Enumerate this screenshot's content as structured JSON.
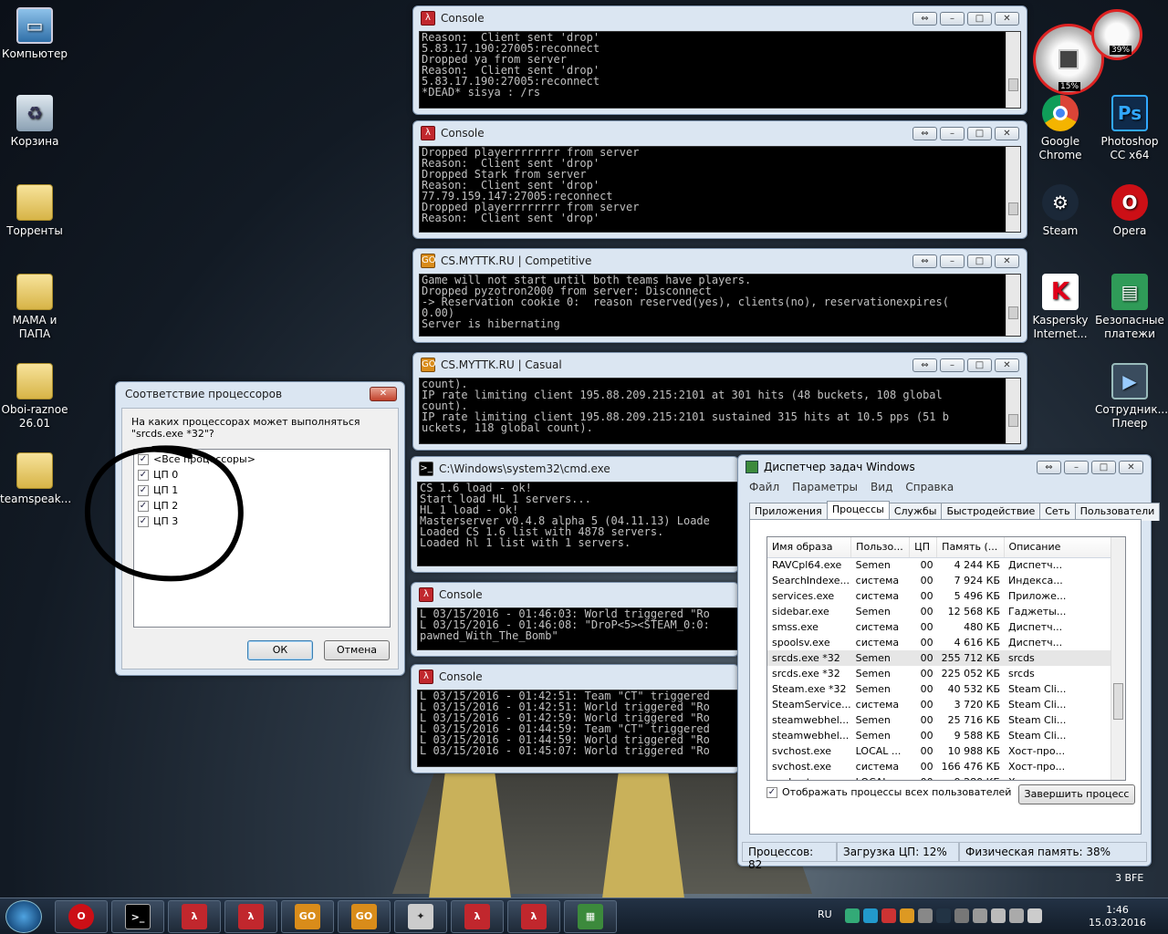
{
  "desktop": {
    "left_icons": [
      {
        "label": "Компьютер",
        "name": "computer-icon"
      },
      {
        "label": "Корзина",
        "name": "recycle-bin-icon"
      },
      {
        "label": "Торренты",
        "name": "folder-icon"
      },
      {
        "label": "МАМА и ПАПА",
        "name": "folder-icon"
      },
      {
        "label": "Oboi-raznoe 26.01",
        "name": "folder-icon"
      },
      {
        "label": "teamspeak...",
        "name": "folder-icon"
      }
    ],
    "right_icons": [
      {
        "label": "Google Chrome",
        "name": "chrome-icon",
        "color": "#2e9e4d"
      },
      {
        "label": "Photoshop CC x64",
        "name": "photoshop-icon",
        "color": "#0f2a4a"
      },
      {
        "label": "Steam",
        "name": "steam-icon",
        "color": "#1b2838"
      },
      {
        "label": "Opera",
        "name": "opera-icon",
        "color": "#cc0f16"
      },
      {
        "label": "Kaspersky Internet...",
        "name": "kaspersky-icon",
        "color": "#e0001a"
      },
      {
        "label": "Безопасные платежи",
        "name": "safe-money-icon",
        "color": "#2f9b58"
      },
      {
        "label": "Сотрудник... Плеер",
        "name": "player-icon",
        "color": "#3a4c5e"
      }
    ],
    "gadget": {
      "cpu": "15%",
      "mem": "39%"
    },
    "build": "3 BFE"
  },
  "consoles": [
    {
      "title": "Console",
      "lines": [
        "Reason:  Client sent 'drop'",
        "5.83.17.190:27005:reconnect",
        "Dropped ya from server",
        "Reason:  Client sent 'drop'",
        "5.83.17.190:27005:reconnect",
        "*DEAD* sisya : /rs"
      ]
    },
    {
      "title": "Console",
      "lines": [
        "Dropped playerrrrrrrr from server",
        "Reason:  Client sent 'drop'",
        "Dropped Stark from server",
        "Reason:  Client sent 'drop'",
        "77.79.159.147:27005:reconnect",
        "Dropped playerrrrrrrr from server",
        "Reason:  Client sent 'drop'"
      ]
    },
    {
      "title": "CS.MYTTK.RU | Competitive",
      "lines": [
        "Game will not start until both teams have players.",
        "Dropped pyzotron2000 from server: Disconnect",
        "-> Reservation cookie 0:  reason reserved(yes), clients(no), reservationexpires(",
        "0.00)",
        "Server is hibernating"
      ]
    },
    {
      "title": "CS.MYTTK.RU | Casual",
      "lines": [
        "count).",
        "IP rate limiting client 195.88.209.215:2101 at 301 hits (48 buckets, 108 global",
        "count).",
        "IP rate limiting client 195.88.209.215:2101 sustained 315 hits at 10.5 pps (51 b",
        "uckets, 118 global count)."
      ]
    },
    {
      "title": "C:\\Windows\\system32\\cmd.exe",
      "lines": [
        "CS 1.6 load - ok!",
        "Start load HL 1 servers...",
        "HL 1 load - ok!",
        "Masterserver v0.4.8 alpha 5 (04.11.13) Loade",
        "",
        "Loaded CS 1.6 list with 4878 servers.",
        "Loaded hl 1 list with 1 servers."
      ]
    },
    {
      "title": "Console",
      "lines": [
        "L 03/15/2016 - 01:46:03: World triggered \"Ro",
        "L 03/15/2016 - 01:46:08: \"DroP<5><STEAM_0:0:",
        "pawned_With_The_Bomb\""
      ]
    },
    {
      "title": "Console",
      "lines": [
        "L 03/15/2016 - 01:42:51: Team \"CT\" triggered",
        "L 03/15/2016 - 01:42:51: World triggered \"Ro",
        "L 03/15/2016 - 01:42:59: World triggered \"Ro",
        "L 03/15/2016 - 01:44:59: Team \"CT\" triggered",
        "L 03/15/2016 - 01:44:59: World triggered \"Ro",
        "L 03/15/2016 - 01:45:07: World triggered \"Ro"
      ]
    }
  ],
  "affinity": {
    "title": "Соответствие процессоров",
    "question": "На каких процессорах может выполняться \"srcds.exe *32\"?",
    "items": [
      "<Все процессоры>",
      "ЦП 0",
      "ЦП 1",
      "ЦП 2",
      "ЦП 3"
    ],
    "ok": "ОК",
    "cancel": "Отмена"
  },
  "taskmgr": {
    "title": "Диспетчер задач Windows",
    "menu": [
      "Файл",
      "Параметры",
      "Вид",
      "Справка"
    ],
    "tabs": [
      "Приложения",
      "Процессы",
      "Службы",
      "Быстродействие",
      "Сеть",
      "Пользователи"
    ],
    "columns": [
      "Имя образа",
      "Пользо...",
      "ЦП",
      "Память (...",
      "Описание"
    ],
    "rows": [
      [
        "RAVCpl64.exe",
        "Semen",
        "00",
        "4 244 КБ",
        "Диспетч..."
      ],
      [
        "SearchIndexe...",
        "система",
        "00",
        "7 924 КБ",
        "Индекса..."
      ],
      [
        "services.exe",
        "система",
        "00",
        "5 496 КБ",
        "Приложе..."
      ],
      [
        "sidebar.exe",
        "Semen",
        "00",
        "12 568 КБ",
        "Гаджеты..."
      ],
      [
        "smss.exe",
        "система",
        "00",
        "480 КБ",
        "Диспетч..."
      ],
      [
        "spoolsv.exe",
        "система",
        "00",
        "4 616 КБ",
        "Диспетч..."
      ],
      [
        "srcds.exe *32",
        "Semen",
        "00",
        "255 712 КБ",
        "srcds"
      ],
      [
        "srcds.exe *32",
        "Semen",
        "00",
        "225 052 КБ",
        "srcds"
      ],
      [
        "Steam.exe *32",
        "Semen",
        "00",
        "40 532 КБ",
        "Steam Cli..."
      ],
      [
        "SteamService...",
        "система",
        "00",
        "3 720 КБ",
        "Steam Cli..."
      ],
      [
        "steamwebhel...",
        "Semen",
        "00",
        "25 716 КБ",
        "Steam Cli..."
      ],
      [
        "steamwebhel...",
        "Semen",
        "00",
        "9 588 КБ",
        "Steam Cli..."
      ],
      [
        "svchost.exe",
        "LOCAL ...",
        "00",
        "10 988 КБ",
        "Хост-про..."
      ],
      [
        "svchost.exe",
        "система",
        "00",
        "166 476 КБ",
        "Хост-про..."
      ],
      [
        "svchost.exe",
        "LOCAL ...",
        "00",
        "9 280 КБ",
        "Хост-про..."
      ]
    ],
    "show_all_label": "Отображать процессы всех пользователей",
    "end_process": "Завершить процесс",
    "status_processes": "Процессов: 82",
    "status_cpu": "Загрузка ЦП: 12%",
    "status_mem": "Физическая память: 38%"
  },
  "taskbar": {
    "lang": "RU",
    "time": "1:46",
    "date": "15.03.2016"
  }
}
